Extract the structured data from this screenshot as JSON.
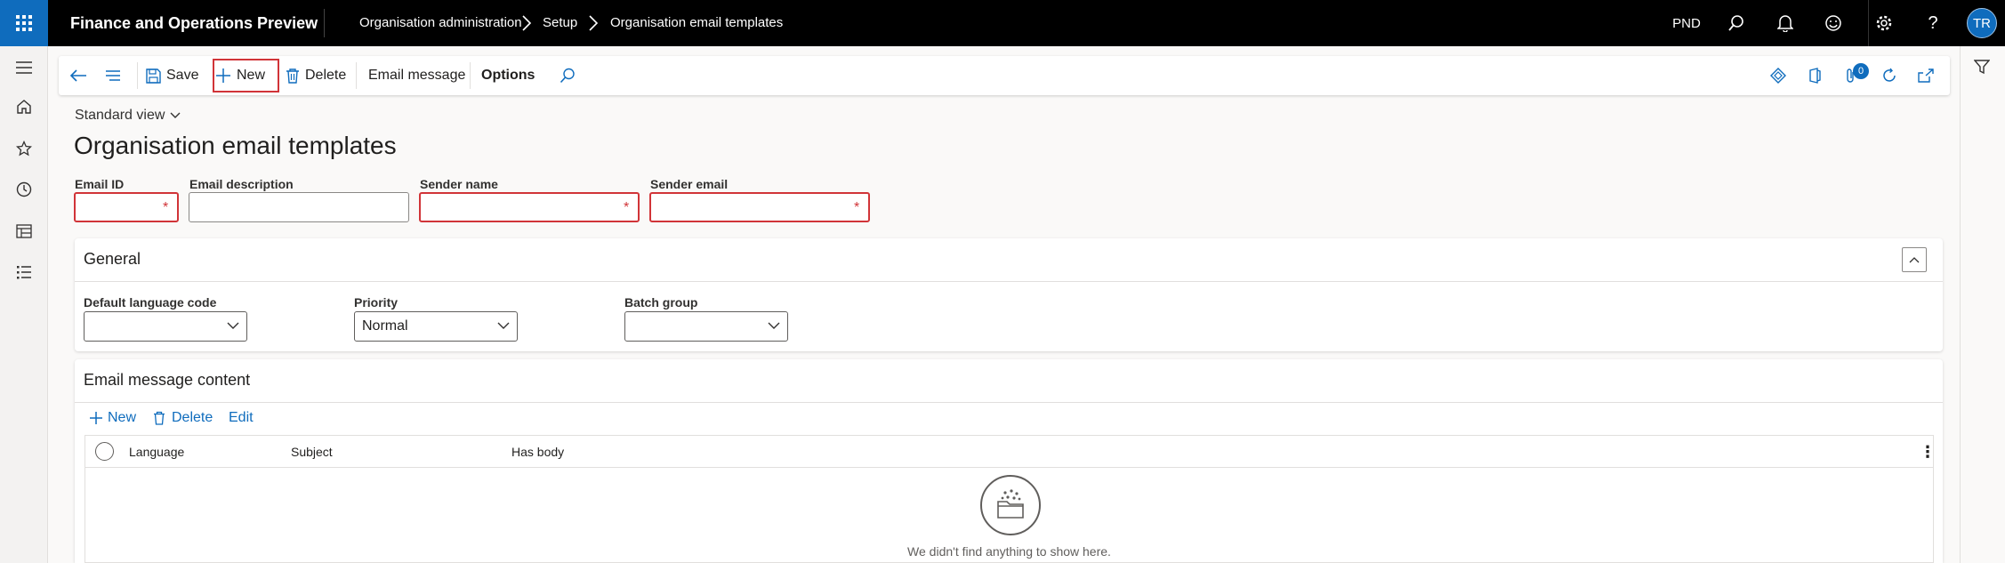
{
  "header": {
    "app_title": "Finance and Operations Preview",
    "breadcrumbs": [
      "Organisation administration",
      "Setup",
      "Organisation email templates"
    ],
    "company": "PND",
    "user_initials": "TR",
    "brand_color": "#0f6cbd"
  },
  "action_pane": {
    "save": "Save",
    "new": "New",
    "delete": "Delete",
    "email_message": "Email message",
    "options": "Options",
    "notification_count": "0"
  },
  "page": {
    "view_name": "Standard view",
    "title": "Organisation email templates"
  },
  "fields": {
    "email_id": {
      "label": "Email ID",
      "value": "",
      "required": true
    },
    "email_description": {
      "label": "Email description",
      "value": ""
    },
    "sender_name": {
      "label": "Sender name",
      "value": "",
      "required": true
    },
    "sender_email": {
      "label": "Sender email",
      "value": "",
      "required": true
    },
    "required_marker": "*"
  },
  "general": {
    "title": "General",
    "default_language_code": {
      "label": "Default language code",
      "value": ""
    },
    "priority": {
      "label": "Priority",
      "value": "Normal"
    },
    "batch_group": {
      "label": "Batch group",
      "value": ""
    }
  },
  "email_content": {
    "title": "Email message content",
    "actions": {
      "new": "New",
      "delete": "Delete",
      "edit": "Edit"
    },
    "columns": [
      "Language",
      "Subject",
      "Has body"
    ],
    "empty_message": "We didn't find anything to show here."
  }
}
